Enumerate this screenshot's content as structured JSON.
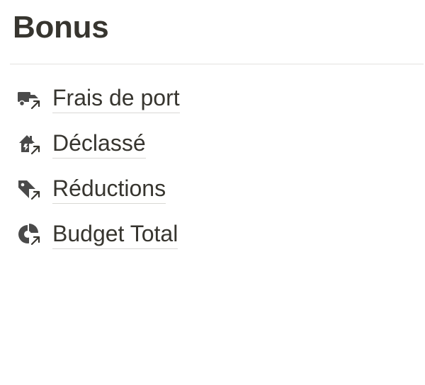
{
  "page": {
    "title": "Bonus"
  },
  "links": [
    {
      "label": "Frais de port",
      "icon": "truck-icon"
    },
    {
      "label": "Déclassé",
      "icon": "house-tag-icon"
    },
    {
      "label": "Réductions",
      "icon": "tags-icon"
    },
    {
      "label": "Budget Total",
      "icon": "pie-chart-icon"
    }
  ],
  "colors": {
    "text": "#37352f",
    "icon": "#4a4a4a",
    "divider": "#e3e2e0",
    "underline": "#d9d8d5",
    "background": "#ffffff"
  }
}
